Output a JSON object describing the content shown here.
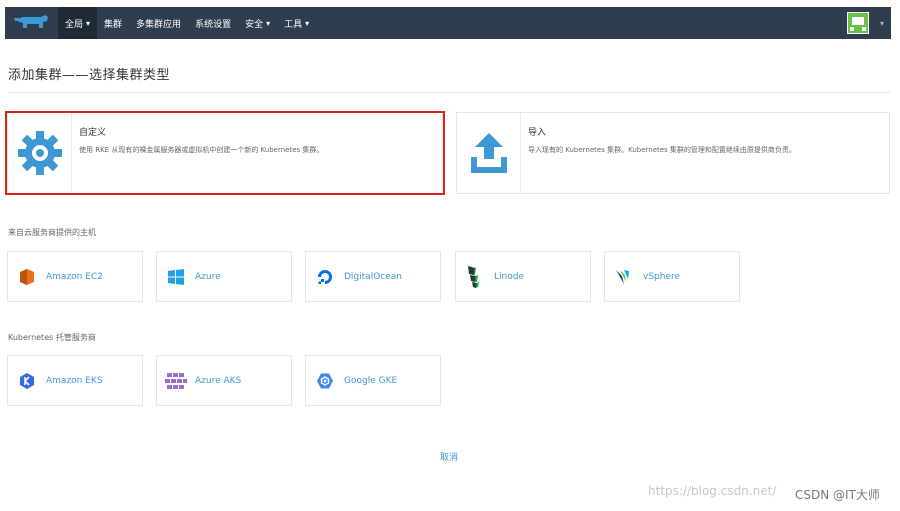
{
  "nav": {
    "logo_icon": "rancher-logo-icon",
    "items": [
      {
        "label": "全局",
        "dropdown": true,
        "active": true
      },
      {
        "label": "集群",
        "dropdown": false,
        "active": false
      },
      {
        "label": "多集群应用",
        "dropdown": false,
        "active": false
      },
      {
        "label": "系统设置",
        "dropdown": false,
        "active": false
      },
      {
        "label": "安全",
        "dropdown": true,
        "active": false
      },
      {
        "label": "工具",
        "dropdown": true,
        "active": false
      }
    ],
    "caret": "⌄",
    "avatar_icon": "user-avatar-icon"
  },
  "page": {
    "title": "添加集群——选择集群类型",
    "cancel_label": "取消"
  },
  "cluster_types": [
    {
      "title": "自定义",
      "description": "使用 RKE 从现有的裸金属服务器或虚拟机中创建一个新的 Kubernetes 集群。",
      "icon": "gear-icon",
      "highlighted": true
    },
    {
      "title": "导入",
      "description": "导入现有的 Kubernetes 集群。Kubernetes 集群的管理和配置继续由原提供商负责。",
      "icon": "upload-icon",
      "highlighted": false
    }
  ],
  "cloud_section": {
    "label": "来自云服务商提供的主机",
    "providers": [
      {
        "label": "Amazon EC2",
        "icon": "amazon-ec2-icon"
      },
      {
        "label": "Azure",
        "icon": "azure-icon"
      },
      {
        "label": "DigitalOcean",
        "icon": "digitalocean-icon"
      },
      {
        "label": "Linode",
        "icon": "linode-icon"
      },
      {
        "label": "vSphere",
        "icon": "vsphere-icon"
      }
    ]
  },
  "hosted_section": {
    "label": "Kubernetes 托管服务商",
    "providers": [
      {
        "label": "Amazon EKS",
        "icon": "amazon-eks-icon"
      },
      {
        "label": "Azure AKS",
        "icon": "azure-aks-icon"
      },
      {
        "label": "Google GKE",
        "icon": "google-gke-icon"
      }
    ]
  },
  "colors": {
    "topbar": "#2f3e4f",
    "accent": "#3d98d3",
    "highlight": "#d9231e"
  },
  "watermark": {
    "url_text": "https://blog.csdn.net/",
    "brand_text": "CSDN @IT大师"
  }
}
